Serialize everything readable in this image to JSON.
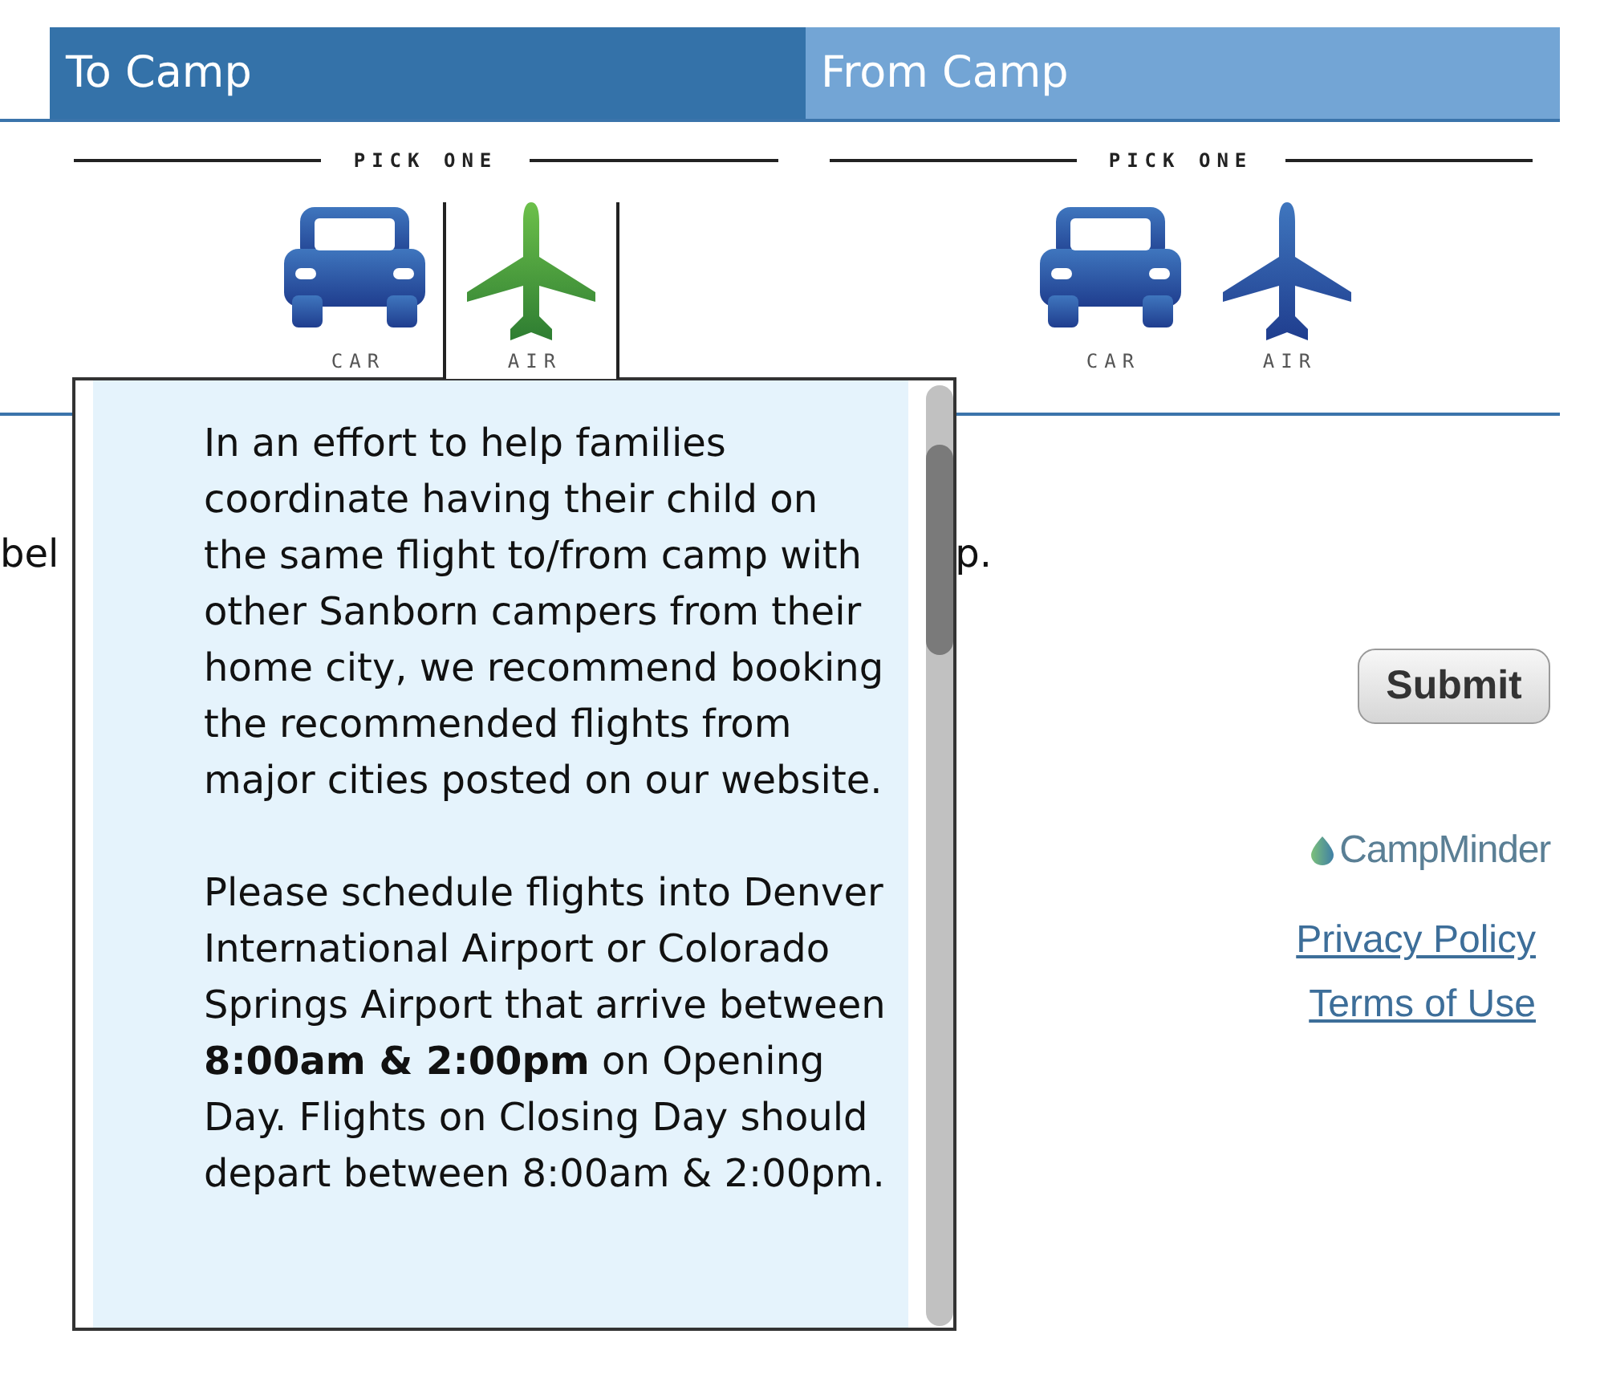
{
  "tabs": [
    {
      "label": "To Camp",
      "selected": true
    },
    {
      "label": "From Camp",
      "selected": false
    }
  ],
  "trip_legs": [
    {
      "heading": "PICK ONE",
      "options": [
        {
          "kind": "car",
          "label": "CAR",
          "selected": false
        },
        {
          "kind": "air",
          "label": "AIR",
          "selected": true
        }
      ]
    },
    {
      "heading": "PICK ONE",
      "options": [
        {
          "kind": "car",
          "label": "CAR",
          "selected": false
        },
        {
          "kind": "air",
          "label": "AIR",
          "selected": false
        }
      ]
    }
  ],
  "background_text": [
    "bel",
    "p."
  ],
  "info_popup": {
    "paragraphs": [
      "In an effort to help families coordinate having their child on the same flight to/from camp with other Sanborn campers from their home city, we recommend booking the recommended flights from major cities posted on our website.",
      "Please schedule flights into Denver International Airport or Colorado Springs Airport that arrive between **8:00am & 2:00pm** on Opening Day. Flights on Closing Day should depart between 8:00am & 2:00pm."
    ]
  },
  "submit_button": "Submit",
  "footer": {
    "logo_text": "CampMinder",
    "links": [
      "Privacy Policy",
      "Terms of Use"
    ]
  }
}
